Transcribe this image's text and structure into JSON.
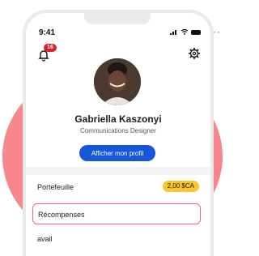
{
  "status_bar": {
    "time": "9:41"
  },
  "notifications": {
    "count": "16"
  },
  "profile": {
    "name": "Gabriella Kaszonyi",
    "role": "Communications Designer",
    "view_profile_label": "Afficher mon profil"
  },
  "menu": {
    "wallet_label": "Portefeuille",
    "wallet_amount": "2,00 $CA",
    "rewards_label": "Récompenses",
    "work_label": "avail"
  },
  "colors": {
    "accent_blue": "#1657d9",
    "badge_red": "#d51f2b",
    "wallet_yellow": "#f9c62d",
    "blob_pink": "#f7878c"
  }
}
